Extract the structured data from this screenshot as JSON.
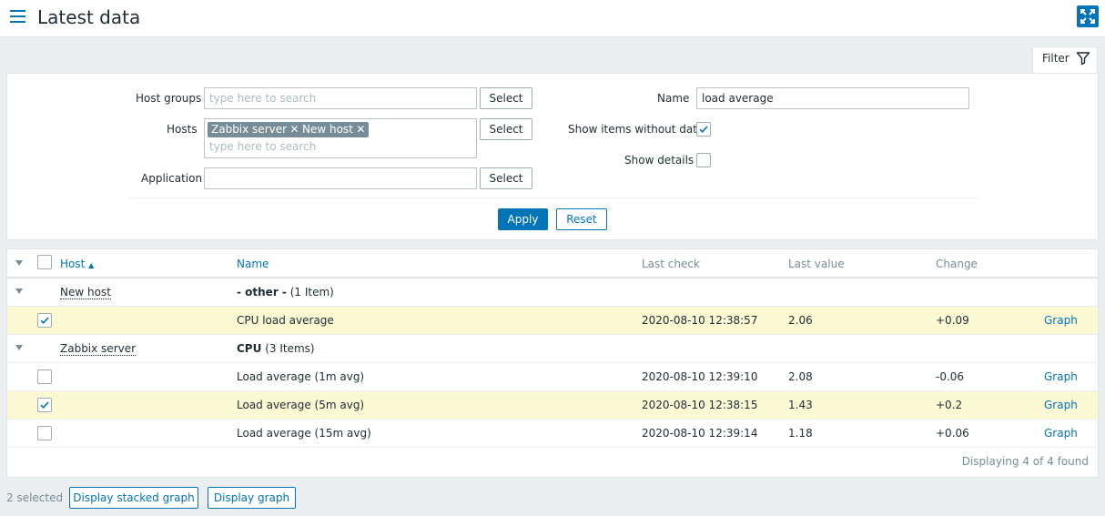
{
  "header": {
    "title": "Latest data"
  },
  "filter": {
    "tab_label": "Filter",
    "host_groups": {
      "label": "Host groups",
      "placeholder": "type here to search",
      "select": "Select"
    },
    "hosts": {
      "label": "Hosts",
      "chips": [
        "Zabbix server",
        "New host"
      ],
      "placeholder": "type here to search",
      "select": "Select"
    },
    "application": {
      "label": "Application",
      "value": "",
      "select": "Select"
    },
    "name": {
      "label": "Name",
      "value": "load average"
    },
    "show_items_without_data": {
      "label": "Show items without data",
      "checked": true
    },
    "show_details": {
      "label": "Show details",
      "checked": false
    },
    "apply": "Apply",
    "reset": "Reset"
  },
  "table": {
    "columns": {
      "host": "Host",
      "name": "Name",
      "last_check": "Last check",
      "last_value": "Last value",
      "change": "Change"
    },
    "rows": [
      {
        "type": "group",
        "host": "New host",
        "name": "- other -",
        "count": "(1 Item)"
      },
      {
        "type": "item",
        "checked": true,
        "name": "CPU load average",
        "last_check": "2020-08-10 12:38:57",
        "last_value": "2.06",
        "change": "+0.09",
        "link": "Graph"
      },
      {
        "type": "group",
        "host": "Zabbix server",
        "name": "CPU",
        "count": "(3 Items)"
      },
      {
        "type": "item",
        "checked": false,
        "name": "Load average (1m avg)",
        "last_check": "2020-08-10 12:39:10",
        "last_value": "2.08",
        "change": "-0.06",
        "link": "Graph"
      },
      {
        "type": "item",
        "checked": true,
        "name": "Load average (5m avg)",
        "last_check": "2020-08-10 12:38:15",
        "last_value": "1.43",
        "change": "+0.2",
        "link": "Graph"
      },
      {
        "type": "item",
        "checked": false,
        "name": "Load average (15m avg)",
        "last_check": "2020-08-10 12:39:14",
        "last_value": "1.18",
        "change": "+0.06",
        "link": "Graph"
      }
    ],
    "footer": "Displaying 4 of 4 found"
  },
  "actions": {
    "selected_count": "2 selected",
    "stacked_graph": "Display stacked graph",
    "graph": "Display graph"
  },
  "colors": {
    "accent": "#0275b8",
    "highlight": "#fbf8d4",
    "chip": "#768d99"
  }
}
